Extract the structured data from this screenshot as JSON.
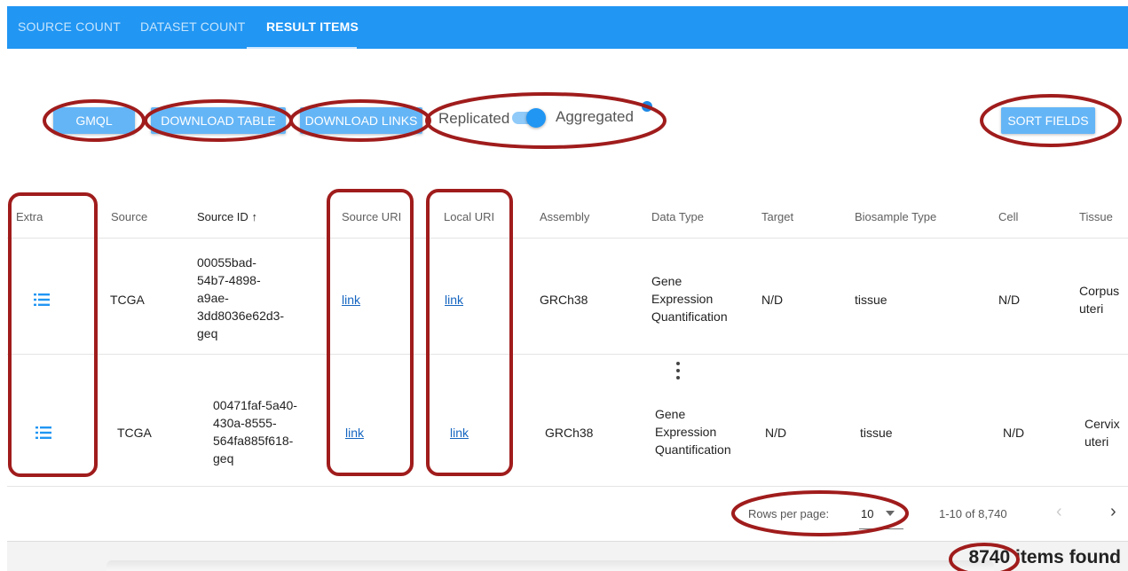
{
  "tabs": [
    {
      "label": "SOURCE COUNT"
    },
    {
      "label": "DATASET COUNT"
    },
    {
      "label": "RESULT ITEMS"
    }
  ],
  "active_tab": "RESULT ITEMS",
  "toolbar": {
    "gmql_label": "GMQL",
    "download_table_label": "DOWNLOAD TABLE",
    "download_links_label": "DOWNLOAD LINKS",
    "toggle_left_label": "Replicated",
    "toggle_right_label": "Aggregated",
    "toggle_state": "Aggregated",
    "sort_fields_label": "SORT FIELDS"
  },
  "table": {
    "columns": [
      "Extra",
      "Source",
      "Source ID",
      "Source URI",
      "Local URI",
      "Assembly",
      "Data Type",
      "Target",
      "Biosample Type",
      "Cell",
      "Tissue"
    ],
    "sort_arrow": "↑",
    "rows": [
      {
        "source": "TCGA",
        "source_id": [
          "00055bad-",
          "54b7-4898-",
          "a9ae-",
          "3dd8036e62d3-",
          "geq"
        ],
        "source_uri": "link",
        "local_uri": "link",
        "assembly": "GRCh38",
        "data_type": [
          "Gene",
          "Expression",
          "Quantification"
        ],
        "target": "N/D",
        "biosample_type": "tissue",
        "cell": "N/D",
        "tissue": [
          "Corpus",
          "uteri"
        ]
      },
      {
        "source": "TCGA",
        "source_id": [
          "00471faf-5a40-",
          "430a-8555-",
          "564fa885f618-",
          "geq"
        ],
        "source_uri": "link",
        "local_uri": "link",
        "assembly": "GRCh38",
        "data_type": [
          "Gene",
          "Expression",
          "Quantification"
        ],
        "target": "N/D",
        "biosample_type": "tissue",
        "cell": "N/D",
        "tissue": [
          "Cervix",
          "uteri"
        ]
      }
    ]
  },
  "pagination": {
    "rows_per_page_label": "Rows per page:",
    "rows_per_page_value": "10",
    "range_text": "1-10 of 8,740",
    "prev": "‹",
    "next": "›"
  },
  "footer": {
    "count": "8740",
    "suffix": "items found"
  },
  "colors": {
    "tab_bar": "#2196f3",
    "button": "#64b5f6",
    "link": "#1565c0",
    "annotation": "#a01c1c"
  },
  "icons": [
    "list-icon",
    "more-vert-icon",
    "chevron-left-icon",
    "chevron-right-icon",
    "dropdown-caret-icon"
  ]
}
